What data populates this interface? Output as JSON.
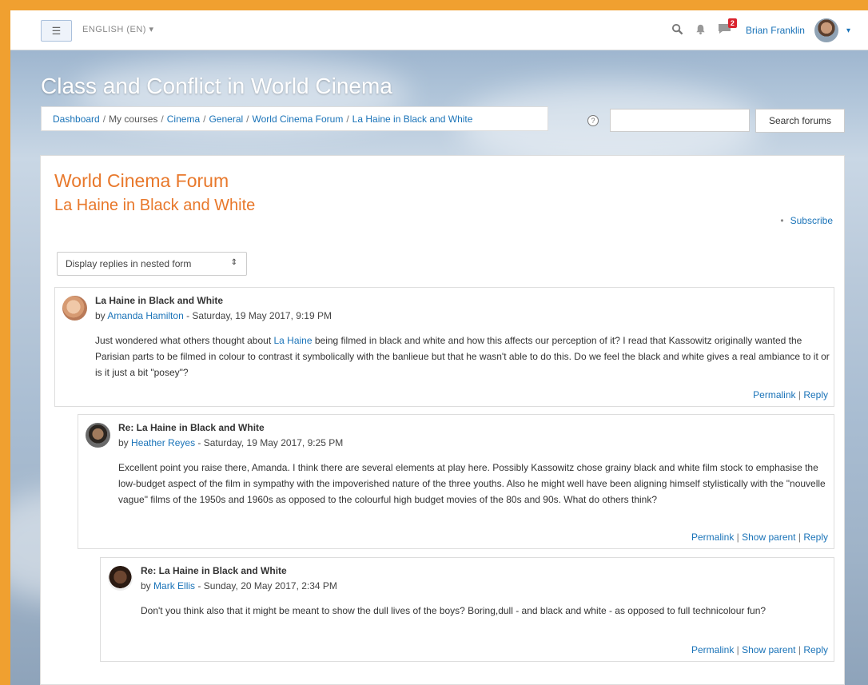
{
  "navbar": {
    "menu_icon": "hamburger-icon",
    "language": "ENGLISH (EN)",
    "language_caret": "▾",
    "search_icon": "search-icon",
    "notification_icon": "bell-icon",
    "messages_icon": "message-icon",
    "messages_badge": "2",
    "user_name": "Brian Franklin",
    "user_caret": "▾"
  },
  "header": {
    "course_title": "Class and Conflict in World Cinema",
    "breadcrumb": [
      "Dashboard",
      "My courses",
      "Cinema",
      "General",
      "World Cinema Forum",
      "La Haine in Black and White"
    ],
    "breadcrumb_sep": "/",
    "help_icon": "?",
    "search_value": "",
    "search_button": "Search forums"
  },
  "content": {
    "forum_title": "World Cinema Forum",
    "discussion_title": "La Haine in Black and White",
    "subscribe_bullet": "•",
    "subscribe": "Subscribe",
    "display_mode": "Display replies in nested form",
    "display_arrows": "⇕"
  },
  "posts": [
    {
      "subject": "La Haine in Black and White",
      "by": "by",
      "author": "Amanda Hamilton",
      "date": " - Saturday, 19 May 2017, 9:19 PM",
      "message_pre": "Just wondered what others thought about ",
      "message_link": "La Haine",
      "message_post": " being filmed in black and white and how this affects our perception of it? I read that Kassowitz originally wanted the Parisian parts to be filmed in colour to contrast it symbolically  with the banlieue but that he wasn't able to do this. Do  we feel the black and white gives a real ambiance to it or is it just a bit \"posey\"?",
      "permalink": "Permalink",
      "reply": "Reply"
    },
    {
      "subject": "Re: La Haine in Black and White",
      "by": "by",
      "author": "Heather Reyes",
      "date": " - Saturday, 19 May 2017, 9:25 PM",
      "message": "Excellent point you raise there, Amanda. I think there are several elements at play here. Possibly Kassowitz chose grainy black and white film stock to emphasise the low-budget aspect of the film in sympathy with the impoverished nature of the three youths. Also he might well have been aligning himself stylistically with the \"nouvelle vague\" films of the 1950s and 1960s as opposed to the  colourful high budget movies of the 80s and 90s. What do others think?",
      "permalink": "Permalink",
      "show_parent": "Show parent",
      "reply": "Reply"
    },
    {
      "subject": "Re: La Haine in Black and White",
      "by": "by",
      "author": "Mark Ellis",
      "date": " - Sunday, 20 May 2017, 2:34 PM",
      "message": "Don't you think also that it might be meant to show the dull lives of the boys?  Boring,dull - and black and white - as opposed to full technicolour fun?",
      "permalink": "Permalink",
      "show_parent": "Show parent",
      "reply": "Reply"
    }
  ],
  "command_sep": " | "
}
